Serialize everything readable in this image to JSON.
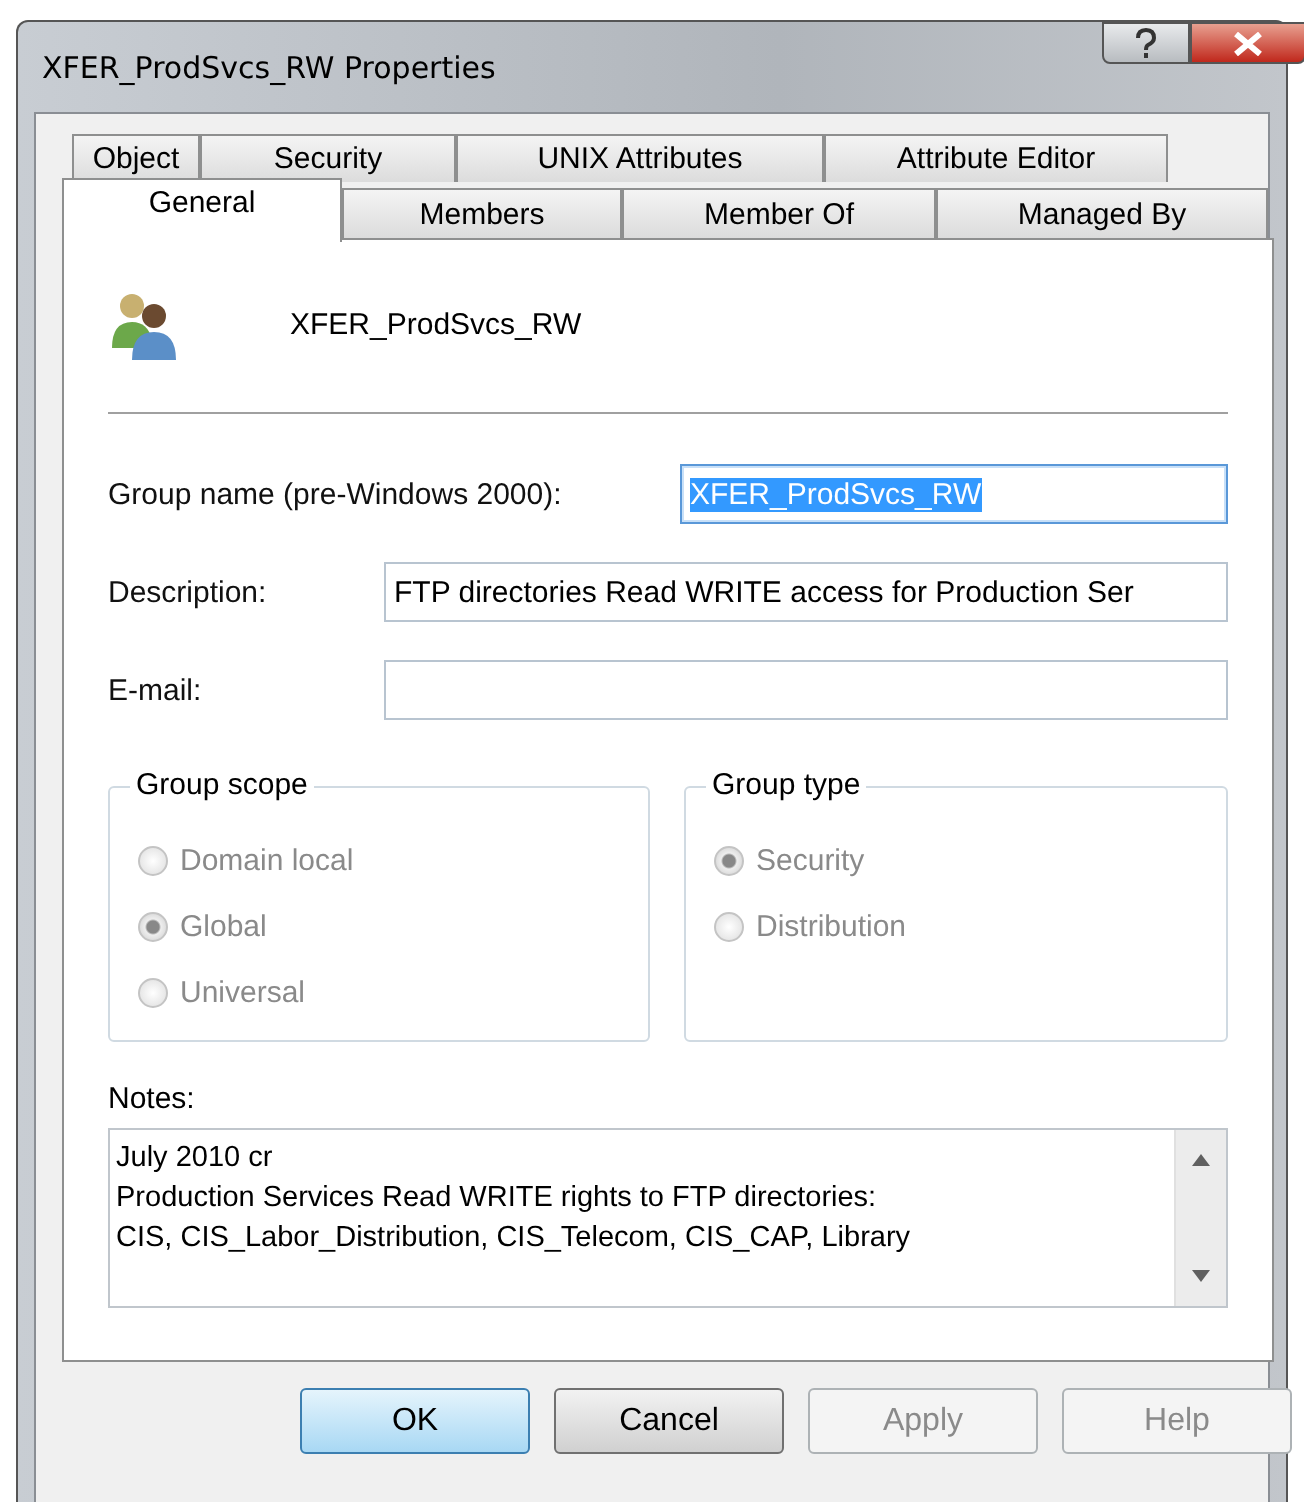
{
  "window": {
    "title": "XFER_ProdSvcs_RW Properties"
  },
  "tab_rows": [
    [
      {
        "label": "Object",
        "selected": false
      },
      {
        "label": "Security",
        "selected": false
      },
      {
        "label": "UNIX Attributes",
        "selected": false
      },
      {
        "label": "Attribute Editor",
        "selected": false
      }
    ],
    [
      {
        "label": "General",
        "selected": true
      },
      {
        "label": "Members",
        "selected": false
      },
      {
        "label": "Member Of",
        "selected": false
      },
      {
        "label": "Managed By",
        "selected": false
      }
    ]
  ],
  "header": {
    "name": "XFER_ProdSvcs_RW"
  },
  "fields": [
    {
      "label": "Group name (pre-Windows 2000):",
      "value": "XFER_ProdSvcs_RW",
      "highlighted": true,
      "kind": "short"
    },
    {
      "label": "Description:",
      "value": "FTP directories Read WRITE access for Production Ser",
      "kind": "wide"
    },
    {
      "label": "E-mail:",
      "kind": "wide"
    }
  ],
  "groups": [
    {
      "title": "Group scope",
      "disabled": true,
      "options": [
        {
          "label": "Domain local",
          "selected": false
        },
        {
          "label": "Global",
          "selected": true
        },
        {
          "label": "Universal",
          "selected": false
        }
      ]
    },
    {
      "title": "Group type",
      "disabled": true,
      "options": [
        {
          "label": "Security",
          "selected": true
        },
        {
          "label": "Distribution",
          "selected": false
        }
      ]
    }
  ],
  "notes": {
    "label": "Notes:",
    "lines": [
      "July 2010 cr",
      "Production Services Read WRITE rights to FTP directories:",
      "CIS, CIS_Labor_Distribution, CIS_Telecom, CIS_CAP, Library"
    ]
  },
  "buttons": [
    {
      "label": "OK",
      "kind": "default"
    },
    {
      "label": "Cancel",
      "kind": "normal"
    },
    {
      "label": "Apply",
      "kind": "disabled"
    },
    {
      "label": "Help",
      "kind": "disabled"
    }
  ]
}
